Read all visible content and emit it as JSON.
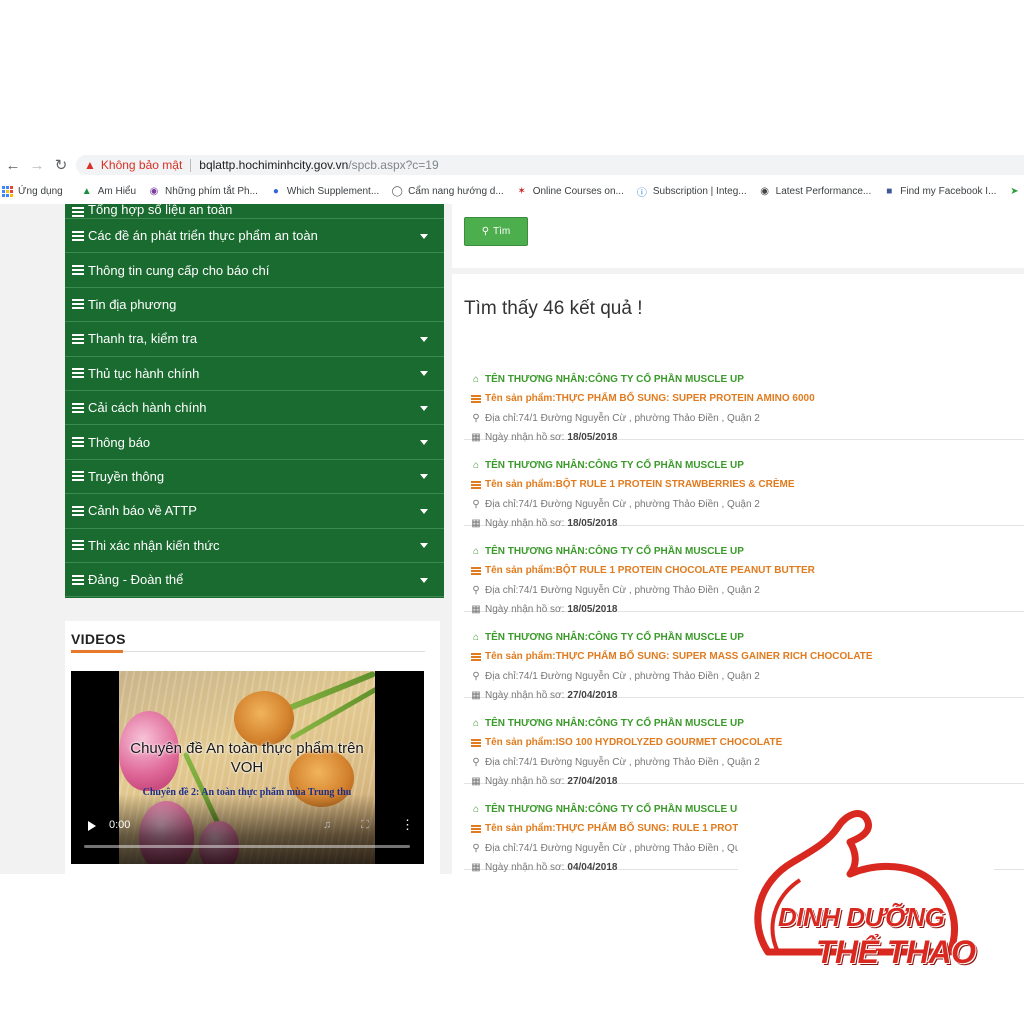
{
  "browser": {
    "security_label": "Không bảo mật",
    "url_host": "bqlattp.hochiminhcity.gov.vn",
    "url_path": "/spcb.aspx?c=19",
    "bookmarks": [
      {
        "label": "Ứng dụng",
        "icon": "apps-icon"
      },
      {
        "label": "Am Hiểu",
        "icon": "bookmark-icon"
      },
      {
        "label": "Những phím tắt Ph...",
        "icon": "bookmark-icon"
      },
      {
        "label": "Which Supplement...",
        "icon": "bookmark-icon"
      },
      {
        "label": "Cẩm nang hướng d...",
        "icon": "bookmark-icon"
      },
      {
        "label": "Online Courses on...",
        "icon": "bookmark-icon"
      },
      {
        "label": "Subscription | Integ...",
        "icon": "bookmark-icon"
      },
      {
        "label": "Latest Performance...",
        "icon": "globe-icon"
      },
      {
        "label": "Find my Facebook I...",
        "icon": "bookmark-icon"
      }
    ]
  },
  "menu": {
    "items": [
      {
        "label": "Tổng hợp số liệu an toàn",
        "has_submenu": false
      },
      {
        "label": "Các đề án phát triển thực phẩm an toàn",
        "has_submenu": true
      },
      {
        "label": "Thông tin cung cấp cho báo chí",
        "has_submenu": false
      },
      {
        "label": "Tin địa phương",
        "has_submenu": false
      },
      {
        "label": "Thanh tra, kiểm tra",
        "has_submenu": true
      },
      {
        "label": "Thủ tục hành chính",
        "has_submenu": true
      },
      {
        "label": "Cải cách hành chính",
        "has_submenu": true
      },
      {
        "label": "Thông báo",
        "has_submenu": true
      },
      {
        "label": "Truyền thông",
        "has_submenu": true
      },
      {
        "label": "Cảnh báo về ATTP",
        "has_submenu": true
      },
      {
        "label": "Thi xác nhận kiến thức",
        "has_submenu": true
      },
      {
        "label": "Đảng - Đoàn thể",
        "has_submenu": true
      }
    ]
  },
  "videos": {
    "title": "VIDEOS",
    "thumb_title": "Chuyên đề An toàn thực phẩm trên VOH",
    "thumb_subtitle": "Chuyên đề 2: An toàn thực phẩm mùa Trung thu",
    "time": "0:00",
    "progress": 0
  },
  "search": {
    "button_label": "Tìm"
  },
  "results": {
    "heading": "Tìm thấy 46 kết quả !",
    "merchant_prefix": "TÊN THƯƠNG NHÂN: ",
    "product_prefix": "Tên sản phẩm: ",
    "address_prefix": "Địa chỉ: ",
    "date_prefix": "Ngày nhận hồ sơ:",
    "items": [
      {
        "merchant": "CÔNG TY CỔ PHẦN MUSCLE UP",
        "product": "THỰC PHẨM BỔ SUNG: SUPER PROTEIN AMINO 6000",
        "address": "74/1 Đường Nguyễn Cừ , phường Thảo Điền , Quận 2",
        "date": "18/05/2018"
      },
      {
        "merchant": "CÔNG TY CỔ PHẦN MUSCLE UP",
        "product": "BỘT RULE 1 PROTEIN STRAWBERRIES & CRÈME",
        "address": "74/1 Đường Nguyễn Cừ , phường Thảo Điền , Quận 2",
        "date": "18/05/2018"
      },
      {
        "merchant": "CÔNG TY CỔ PHẦN MUSCLE UP",
        "product": "BỘT RULE 1 PROTEIN CHOCOLATE PEANUT BUTTER",
        "address": "74/1 Đường Nguyễn Cừ , phường Thảo Điền , Quận 2",
        "date": "18/05/2018"
      },
      {
        "merchant": "CÔNG TY CỔ PHẦN MUSCLE UP",
        "product": "THỰC PHẨM BỔ SUNG: SUPER MASS GAINER RICH CHOCOLATE",
        "address": "74/1 Đường Nguyễn Cừ , phường Thảo Điền , Quận 2",
        "date": "27/04/2018"
      },
      {
        "merchant": "CÔNG TY CỔ PHẦN MUSCLE UP",
        "product": "ISO 100 HYDROLYZED GOURMET CHOCOLATE",
        "address": "74/1 Đường Nguyễn Cừ , phường Thảo Điền , Quận 2",
        "date": "27/04/2018"
      },
      {
        "merchant": "CÔNG TY CỔ PHẦN MUSCLE UP",
        "product": "THỰC PHẨM BỔ SUNG: RULE 1 PROTE",
        "address": "74/1 Đường Nguyễn Cừ , phường Thảo Điền , Quậ",
        "date": "04/04/2018"
      }
    ]
  },
  "logo": {
    "line1": "DINH DƯỠNG",
    "line2": "THỂ THAO",
    "color": "#d8281f"
  },
  "colors": {
    "menu_green": "#1a6b30",
    "button_green": "#4cae4c",
    "merchant_green": "#3a9a2a",
    "product_orange": "#e07b1f",
    "accent_orange": "#e6792b"
  }
}
